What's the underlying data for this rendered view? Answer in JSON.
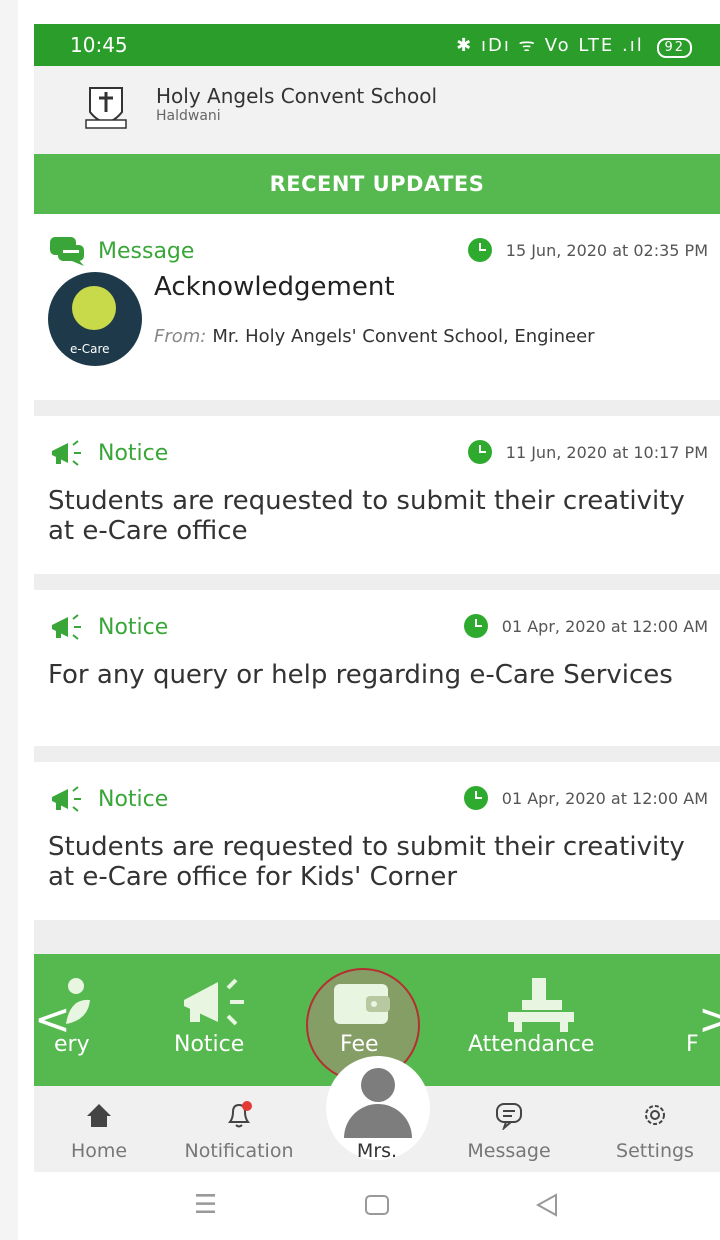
{
  "status_bar": {
    "time": "10:45",
    "icons_text": "✱ ıDı ᯤ Vo LTE .ıl",
    "battery": "92"
  },
  "school": {
    "name": "Holy Angels Convent School",
    "city": "Haldwani"
  },
  "section_title": "RECENT UPDATES",
  "updates": [
    {
      "type": "Message",
      "datetime": "15 Jun, 2020 at 02:35 PM",
      "title": "Acknowledgement",
      "from_label": "From:",
      "from": "Mr. Holy Angels' Convent School, Engineer",
      "logo_text": "e-Care"
    },
    {
      "type": "Notice",
      "datetime": "11 Jun, 2020 at 10:17 PM",
      "text": "Students are requested to submit their creativity at e-Care office"
    },
    {
      "type": "Notice",
      "datetime": "01 Apr, 2020 at 12:00 AM",
      "text": "For any query or help regarding e-Care Services"
    },
    {
      "type": "Notice",
      "datetime": "01 Apr, 2020 at 12:00 AM",
      "text": "Students are requested to submit their creativity at e-Care office for Kids' Corner"
    }
  ],
  "menu": {
    "items": [
      "ery",
      "Notice",
      "Fee",
      "Attendance",
      "F"
    ],
    "left_arrow": "<",
    "right_arrow": ">"
  },
  "tabs": {
    "home": "Home",
    "notification": "Notification",
    "profile": "Mrs.",
    "message": "Message",
    "settings": "Settings"
  },
  "colors": {
    "primary_green": "#56b94f",
    "status_green": "#2a9d2a",
    "accent_text": "#3aa63a"
  }
}
